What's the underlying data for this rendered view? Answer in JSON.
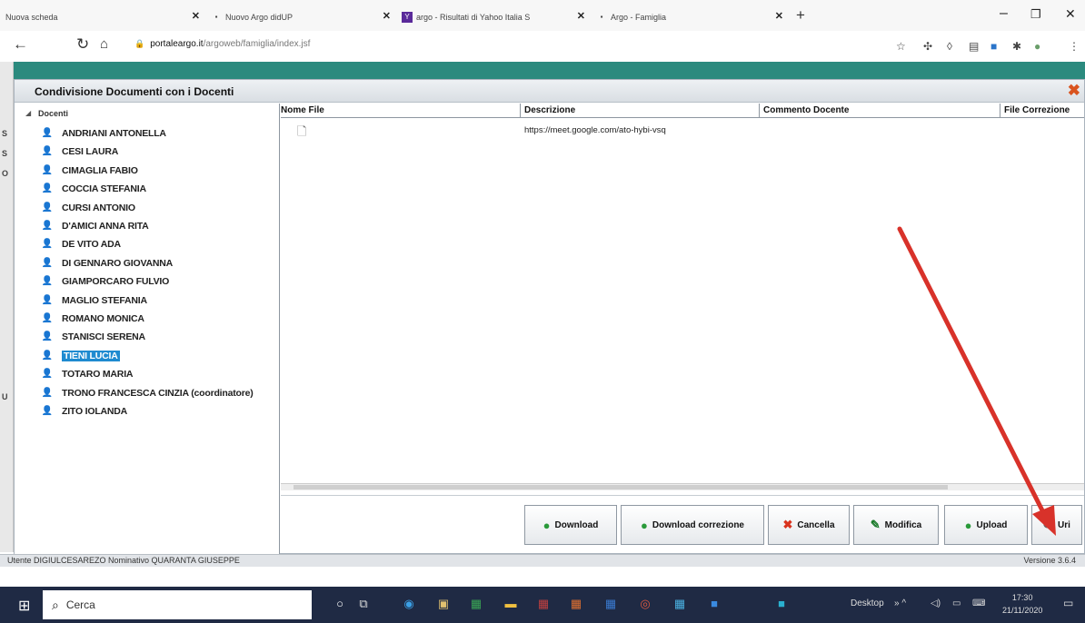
{
  "browser": {
    "tabs": [
      {
        "label": "Nuova scheda",
        "icon": "blank-tab-icon"
      },
      {
        "label": "Nuovo Argo didUP",
        "icon": "argo-icon"
      },
      {
        "label": "argo - Risultati di Yahoo Italia S",
        "icon": "yahoo-icon"
      },
      {
        "label": "Argo - Famiglia",
        "icon": "argo-icon"
      }
    ],
    "new_tab": "+",
    "url_host": "portaleargo.it",
    "url_path": "/argoweb/famiglia/index.jsf"
  },
  "dialog": {
    "title": "Condivisione Documenti con i Docenti",
    "tree_header": "Docenti",
    "teachers": [
      "ANDRIANI ANTONELLA",
      "CESI LAURA",
      "CIMAGLIA FABIO",
      "COCCIA STEFANIA",
      "CURSI ANTONIO",
      "D'AMICI ANNA RITA",
      "DE VITO ADA",
      "DI GENNARO GIOVANNA",
      "GIAMPORCARO FULVIO",
      "MAGLIO STEFANIA",
      "ROMANO MONICA",
      "STANISCI SERENA",
      "TIENI LUCIA",
      "TOTARO MARIA",
      "TRONO FRANCESCA CINZIA (coordinatore)",
      "ZITO IOLANDA"
    ],
    "selected_teacher": "TIENI LUCIA",
    "columns": [
      "Nome File",
      "Descrizione",
      "Commento Docente",
      "File Correzione"
    ],
    "rows": [
      {
        "descrizione": "https://meet.google.com/ato-hybi-vsq"
      }
    ],
    "buttons": {
      "download": "Download",
      "download_correzione": "Download correzione",
      "cancella": "Cancella",
      "modifica": "Modifica",
      "upload": "Upload",
      "uri": "Uri"
    },
    "annotation_color": "#d8322a"
  },
  "status": {
    "left": "Utente DIGIULCESAREZO Nominativo QUARANTA GIUSEPPE",
    "right": "Versione 3.6.4"
  },
  "taskbar": {
    "search_label": "Cerca",
    "desktop_label": "Desktop",
    "time": "17:30",
    "date": "21/11/2020"
  }
}
